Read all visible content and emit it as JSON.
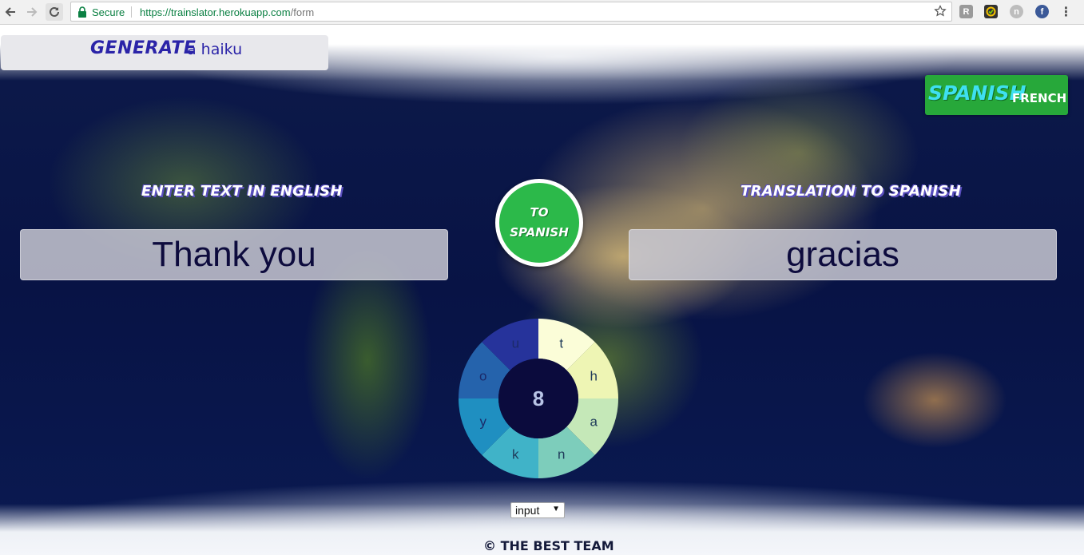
{
  "browser": {
    "secure_label": "Secure",
    "url_host": "https://trainslator.herokuapp.com",
    "url_path": "/form"
  },
  "generate": {
    "word": "GENERATE",
    "rest": "a haiku"
  },
  "language_toggle": {
    "active": "SPANISH",
    "other": "FRENCH"
  },
  "input_heading": "ENTER TEXT IN ENGLISH",
  "output_heading": "TRANSLATION TO SPANISH",
  "input_text": "Thank you",
  "output_text": "gracias",
  "translate_button": {
    "line1": "TO",
    "line2": "SPANISH"
  },
  "letter_wheel": {
    "count": "8",
    "letters": [
      "t",
      "h",
      "a",
      "n",
      "k",
      "y",
      "o",
      "u"
    ],
    "colors": [
      "#fbfdd8",
      "#eef5b4",
      "#c5e8b8",
      "#7dcdbb",
      "#40b3c8",
      "#1f8fc1",
      "#2563ac",
      "#26339b"
    ],
    "center_color": "#0b0b3d"
  },
  "mode_select": {
    "value": "input"
  },
  "footer": "© THE BEST TEAM"
}
